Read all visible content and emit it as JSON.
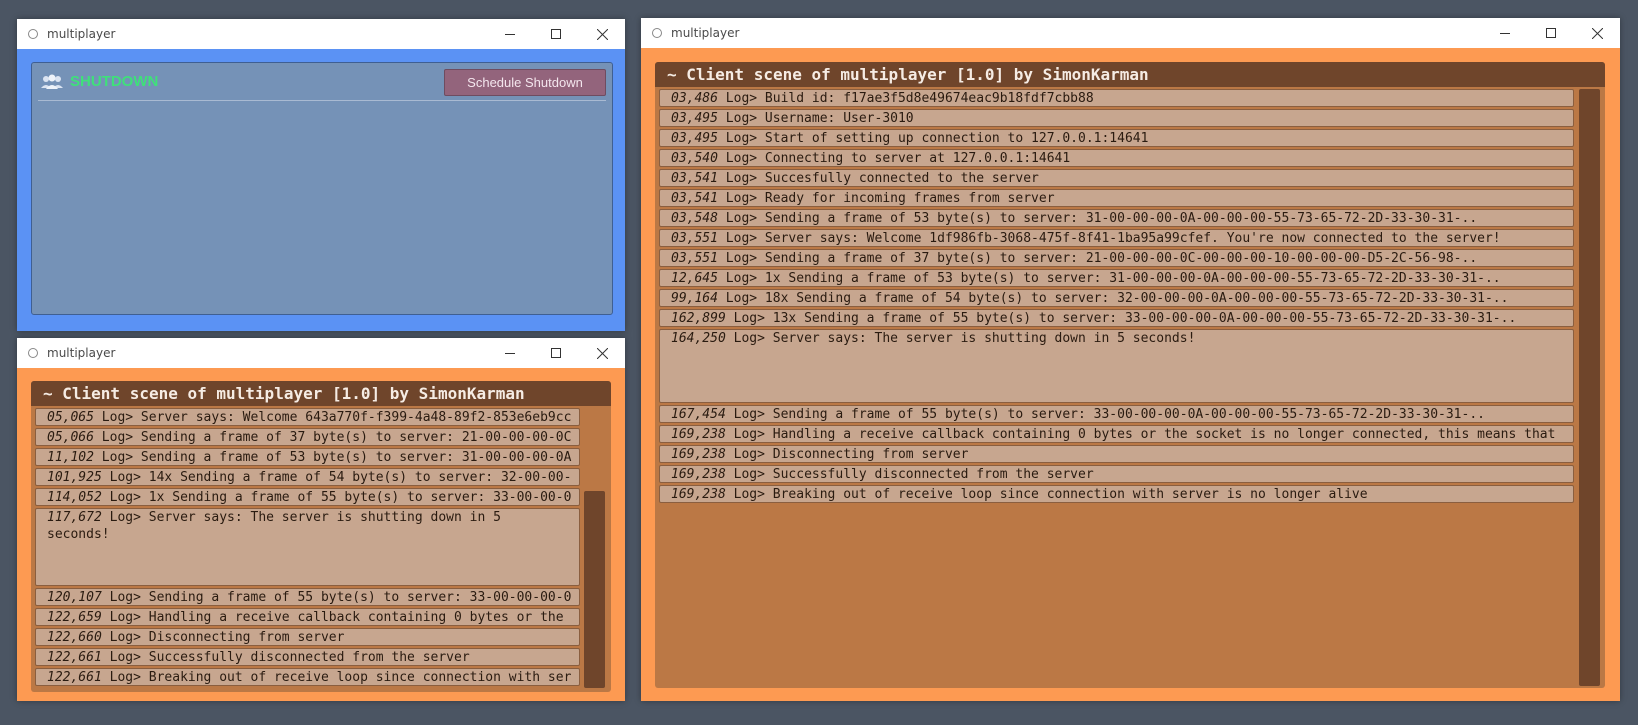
{
  "windows": {
    "shutdown": {
      "title": "multiplayer",
      "heading": "SHUTDOWN",
      "button_label": "Schedule Shutdown"
    },
    "client_small": {
      "title": "multiplayer",
      "header": "~ Client scene of multiplayer [1.0] by SimonKarman",
      "logs": [
        {
          "ts": "05,065",
          "text": " Log> Server says: Welcome 643a770f-f399-4a48-89f2-853e6eb9cc"
        },
        {
          "ts": "05,066",
          "text": " Log> Sending a frame of 37 byte(s) to server: 21-00-00-00-0C"
        },
        {
          "ts": "11,102",
          "text": " Log> Sending a frame of 53 byte(s) to server: 31-00-00-00-0A"
        },
        {
          "ts": "101,925",
          "text": " Log> 14x Sending a frame of 54 byte(s) to server: 32-00-00-"
        },
        {
          "ts": "114,052",
          "text": " Log> 1x Sending a frame of 55 byte(s) to server: 33-00-00-0"
        },
        {
          "ts": "117,672",
          "text": " Log> Server says: The server is shutting down in 5\nseconds!"
        },
        {
          "ts": "120,107",
          "text": " Log> Sending a frame of 55 byte(s) to server: 33-00-00-00-0"
        },
        {
          "ts": "122,659",
          "text": " Log> Handling a receive callback containing 0 bytes or the"
        },
        {
          "ts": "122,660",
          "text": " Log> Disconnecting from server"
        },
        {
          "ts": "122,661",
          "text": " Log> Successfully disconnected from the server"
        },
        {
          "ts": "122,661",
          "text": " Log> Breaking out of receive loop since connection with ser"
        }
      ]
    },
    "client_large": {
      "title": "multiplayer",
      "header": "~ Client scene of multiplayer [1.0] by SimonKarman",
      "logs": [
        {
          "ts": "03,486",
          "text": " Log> Build id: f17ae3f5d8e49674eac9b18fdf7cbb88"
        },
        {
          "ts": "03,495",
          "text": " Log> Username: User-3010"
        },
        {
          "ts": "03,495",
          "text": " Log> Start of setting up connection to 127.0.0.1:14641"
        },
        {
          "ts": "03,540",
          "text": " Log> Connecting to server at 127.0.0.1:14641"
        },
        {
          "ts": "03,541",
          "text": " Log> Succesfully connected to the server"
        },
        {
          "ts": "03,541",
          "text": " Log> Ready for incoming frames from server"
        },
        {
          "ts": "03,548",
          "text": " Log> Sending a frame of 53 byte(s) to server: 31-00-00-00-0A-00-00-00-55-73-65-72-2D-33-30-31-.."
        },
        {
          "ts": "03,551",
          "text": " Log> Server says: Welcome 1df986fb-3068-475f-8f41-1ba95a99cfef. You're now connected to the server!"
        },
        {
          "ts": "03,551",
          "text": " Log> Sending a frame of 37 byte(s) to server: 21-00-00-00-0C-00-00-00-10-00-00-00-D5-2C-56-98-.."
        },
        {
          "ts": "12,645",
          "text": " Log> 1x Sending a frame of 53 byte(s) to server: 31-00-00-00-0A-00-00-00-55-73-65-72-2D-33-30-31-.."
        },
        {
          "ts": "99,164",
          "text": " Log> 18x Sending a frame of 54 byte(s) to server: 32-00-00-00-0A-00-00-00-55-73-65-72-2D-33-30-31-.."
        },
        {
          "ts": "162,899",
          "text": " Log> 13x Sending a frame of 55 byte(s) to server: 33-00-00-00-0A-00-00-00-55-73-65-72-2D-33-30-31-.."
        },
        {
          "ts": "164,250",
          "text": " Log> Server says: The server is shutting down in 5 seconds!"
        },
        {
          "ts": "167,454",
          "text": " Log> Sending a frame of 55 byte(s) to server: 33-00-00-00-0A-00-00-00-55-73-65-72-2D-33-30-31-.."
        },
        {
          "ts": "169,238",
          "text": " Log> Handling a receive callback containing 0 bytes or the socket is no longer connected, this means that"
        },
        {
          "ts": "169,238",
          "text": " Log> Disconnecting from server"
        },
        {
          "ts": "169,238",
          "text": " Log> Successfully disconnected from the server"
        },
        {
          "ts": "169,238",
          "text": " Log> Breaking out of receive loop since connection with server is no longer alive"
        }
      ]
    }
  },
  "colors": {
    "desktop": "#4b5563",
    "shutdown_bg": "#5b92f4",
    "shutdown_heading": "#3fe07a",
    "client_bg": "#fd9a52",
    "log_frame": "#bb7845",
    "log_header": "#6f452b",
    "log_row": "#c7a68f"
  },
  "icons": [
    "window-icon",
    "minimize-icon",
    "maximize-icon",
    "close-icon",
    "users-icon"
  ]
}
